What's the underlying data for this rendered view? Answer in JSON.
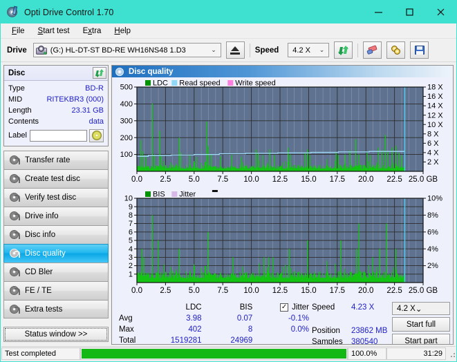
{
  "window": {
    "title": "Opti Drive Control 1.70",
    "app_icon": "disc-pen-icon",
    "minimize": "–",
    "maximize": "□",
    "close": "✕",
    "titlebar_color": "#3ee0cf"
  },
  "menubar": {
    "items": [
      {
        "label": "File",
        "accel": "F"
      },
      {
        "label": "Start test",
        "accel": "S"
      },
      {
        "label": "Extra",
        "accel": "x"
      },
      {
        "label": "Help",
        "accel": "H"
      }
    ]
  },
  "toolbar": {
    "drive_label": "Drive",
    "drive_value": "(G:)  HL-DT-ST BD-RE  WH16NS48 1.D3",
    "drive_icon": "drive-icon",
    "eject_icon": "eject-icon",
    "speed_label": "Speed",
    "speed_value": "4.2 X",
    "refresh_icon": "refresh-icon",
    "erase_icon": "eraser-icon",
    "settings_icon": "gold-discs-icon",
    "save_icon": "save-icon",
    "chevron": "⌄"
  },
  "disc_panel": {
    "title": "Disc",
    "refresh_icon": "refresh-icon",
    "rows": [
      {
        "key": "Type",
        "value": "BD-R"
      },
      {
        "key": "MID",
        "value": "RITEKBR3 (000)"
      },
      {
        "key": "Length",
        "value": "23.31 GB"
      },
      {
        "key": "Contents",
        "value": "data"
      }
    ],
    "label_key": "Label",
    "label_value": "",
    "label_placeholder": "",
    "label_button_icon": "cd-icon"
  },
  "nav": {
    "items": [
      {
        "label": "Transfer rate",
        "icon": "disc-icon",
        "active": false
      },
      {
        "label": "Create test disc",
        "icon": "disc-icon",
        "active": false
      },
      {
        "label": "Verify test disc",
        "icon": "disc-icon",
        "active": false
      },
      {
        "label": "Drive info",
        "icon": "disc-icon",
        "active": false
      },
      {
        "label": "Disc info",
        "icon": "disc-icon",
        "active": false
      },
      {
        "label": "Disc quality",
        "icon": "disc-icon",
        "active": true
      },
      {
        "label": "CD Bler",
        "icon": "disc-icon",
        "active": false
      },
      {
        "label": "FE / TE",
        "icon": "disc-icon",
        "active": false
      },
      {
        "label": "Extra tests",
        "icon": "disc-icon",
        "active": false
      }
    ],
    "status_window_button": "Status window >>"
  },
  "main": {
    "header_title": "Disc quality",
    "header_icon": "disc-icon"
  },
  "stats": {
    "col_headers": [
      "LDC",
      "BIS"
    ],
    "jitter_label": "Jitter",
    "jitter_checked": true,
    "rows": [
      {
        "key": "Avg",
        "ldc": "3.98",
        "bis": "0.07",
        "jitter": "-0.1%"
      },
      {
        "key": "Max",
        "ldc": "402",
        "bis": "8",
        "jitter": "0.0%"
      },
      {
        "key": "Total",
        "ldc": "1519281",
        "bis": "24969",
        "jitter": ""
      }
    ],
    "right": [
      {
        "key": "Speed",
        "value": "4.23 X"
      },
      {
        "key": "Position",
        "value": "23862 MB"
      },
      {
        "key": "Samples",
        "value": "380540"
      }
    ],
    "speed_select": "4.2 X",
    "start_full_button": "Start full",
    "start_part_button": "Start part"
  },
  "statusbar": {
    "message": "Test completed",
    "progress_percent": 100.0,
    "progress_text": "100.0%",
    "elapsed": "31:29"
  },
  "chart_data": [
    {
      "type": "line",
      "id": "ldc-chart",
      "title": "",
      "xlabel": "GB",
      "ylabel": "",
      "xlim": [
        0,
        25.0
      ],
      "xticks": [
        "0.0",
        "2.5",
        "5.0",
        "7.5",
        "10.0",
        "12.5",
        "15.0",
        "17.5",
        "20.0",
        "22.5",
        "25.0 GB"
      ],
      "ylim": [
        0,
        500
      ],
      "yticks": [
        "100",
        "200",
        "300",
        "400",
        "500"
      ],
      "y2lim": [
        0,
        18
      ],
      "y2ticks": [
        "2 X",
        "4 X",
        "6 X",
        "8 X",
        "10 X",
        "12 X",
        "14 X",
        "16 X",
        "18 X"
      ],
      "grid": true,
      "plot_bg": "#5f7390",
      "legend": [
        {
          "name": "LDC",
          "color": "#009000"
        },
        {
          "name": "Read speed",
          "color": "#8fd8f7"
        },
        {
          "name": "Write speed",
          "color": "#ff7fe0"
        }
      ],
      "series": [
        {
          "name": "LDC",
          "color": "#14c414",
          "kind": "impulse",
          "x_end": 23.4,
          "baseline": 30,
          "noise_amp": 28,
          "spikes": [
            {
              "x": 0.35,
              "y": 185
            },
            {
              "x": 0.5,
              "y": 120
            },
            {
              "x": 0.8,
              "y": 95
            },
            {
              "x": 1.35,
              "y": 402
            },
            {
              "x": 1.55,
              "y": 100
            },
            {
              "x": 2.0,
              "y": 240
            },
            {
              "x": 2.15,
              "y": 90
            },
            {
              "x": 3.7,
              "y": 200
            },
            {
              "x": 3.85,
              "y": 110
            },
            {
              "x": 4.6,
              "y": 95
            },
            {
              "x": 5.2,
              "y": 85
            },
            {
              "x": 6.1,
              "y": 295
            },
            {
              "x": 6.25,
              "y": 150
            },
            {
              "x": 6.5,
              "y": 100
            },
            {
              "x": 7.3,
              "y": 90
            },
            {
              "x": 8.3,
              "y": 95
            },
            {
              "x": 9.1,
              "y": 85
            },
            {
              "x": 10.4,
              "y": 130
            },
            {
              "x": 10.6,
              "y": 110
            },
            {
              "x": 11.0,
              "y": 95
            },
            {
              "x": 11.6,
              "y": 130
            },
            {
              "x": 12.0,
              "y": 95
            },
            {
              "x": 13.2,
              "y": 140
            },
            {
              "x": 13.4,
              "y": 100
            },
            {
              "x": 14.7,
              "y": 110
            },
            {
              "x": 14.9,
              "y": 130
            },
            {
              "x": 15.1,
              "y": 95
            },
            {
              "x": 17.4,
              "y": 115
            },
            {
              "x": 17.6,
              "y": 95
            },
            {
              "x": 18.2,
              "y": 100
            },
            {
              "x": 18.6,
              "y": 125
            },
            {
              "x": 19.1,
              "y": 190
            },
            {
              "x": 19.4,
              "y": 100
            },
            {
              "x": 20.1,
              "y": 110
            },
            {
              "x": 20.4,
              "y": 95
            },
            {
              "x": 21.1,
              "y": 140
            },
            {
              "x": 21.4,
              "y": 125
            },
            {
              "x": 21.7,
              "y": 215
            },
            {
              "x": 21.9,
              "y": 120
            },
            {
              "x": 22.3,
              "y": 140
            },
            {
              "x": 22.6,
              "y": 150
            },
            {
              "x": 22.9,
              "y": 110
            },
            {
              "x": 23.1,
              "y": 95
            }
          ]
        },
        {
          "name": "Read speed",
          "color": "#9fdcf8",
          "kind": "step",
          "points": [
            {
              "x": 0.0,
              "y": 3.2
            },
            {
              "x": 1.0,
              "y": 3.2
            },
            {
              "x": 1.0,
              "y": 3.4
            },
            {
              "x": 3.0,
              "y": 3.4
            },
            {
              "x": 3.0,
              "y": 3.5
            },
            {
              "x": 5.0,
              "y": 3.5
            },
            {
              "x": 5.0,
              "y": 3.6
            },
            {
              "x": 7.2,
              "y": 3.6
            },
            {
              "x": 7.2,
              "y": 3.75
            },
            {
              "x": 9.5,
              "y": 3.75
            },
            {
              "x": 9.5,
              "y": 3.85
            },
            {
              "x": 12.3,
              "y": 3.85
            },
            {
              "x": 12.3,
              "y": 3.95
            },
            {
              "x": 15.2,
              "y": 3.95
            },
            {
              "x": 15.2,
              "y": 4.05
            },
            {
              "x": 17.6,
              "y": 4.05
            },
            {
              "x": 17.6,
              "y": 4.15
            },
            {
              "x": 20.3,
              "y": 4.15
            },
            {
              "x": 20.3,
              "y": 4.25
            },
            {
              "x": 23.4,
              "y": 4.25
            }
          ]
        },
        {
          "name": "position-marker",
          "color": "#4fd2f5",
          "kind": "vline",
          "x": 23.4
        }
      ]
    },
    {
      "type": "line",
      "id": "bis-chart",
      "title": "",
      "xlabel": "GB",
      "ylabel": "",
      "xlim": [
        0,
        25.0
      ],
      "xticks": [
        "0.0",
        "2.5",
        "5.0",
        "7.5",
        "10.0",
        "12.5",
        "15.0",
        "17.5",
        "20.0",
        "22.5",
        "25.0 GB"
      ],
      "ylim": [
        0,
        10
      ],
      "yticks": [
        "1",
        "2",
        "3",
        "4",
        "5",
        "6",
        "7",
        "8",
        "9",
        "10"
      ],
      "y2lim": [
        0,
        10
      ],
      "y2ticks": [
        "2%",
        "4%",
        "6%",
        "8%",
        "10%"
      ],
      "grid": true,
      "plot_bg": "#5f7390",
      "legend": [
        {
          "name": "BIS",
          "color": "#009000"
        },
        {
          "name": "Jitter",
          "color": "#d9b8e8"
        }
      ],
      "series": [
        {
          "name": "BIS",
          "color": "#14c414",
          "kind": "impulse",
          "x_end": 23.4,
          "baseline": 1.0,
          "noise_amp": 1.0,
          "spikes": [
            {
              "x": 0.45,
              "y": 4
            },
            {
              "x": 0.6,
              "y": 3
            },
            {
              "x": 1.35,
              "y": 8
            },
            {
              "x": 1.85,
              "y": 5
            },
            {
              "x": 3.7,
              "y": 4
            },
            {
              "x": 6.2,
              "y": 6
            },
            {
              "x": 8.4,
              "y": 3
            },
            {
              "x": 11.1,
              "y": 3
            },
            {
              "x": 11.5,
              "y": 3
            },
            {
              "x": 11.9,
              "y": 3
            },
            {
              "x": 13.3,
              "y": 4
            },
            {
              "x": 14.9,
              "y": 5
            },
            {
              "x": 17.8,
              "y": 5
            },
            {
              "x": 19.4,
              "y": 7
            },
            {
              "x": 19.2,
              "y": 4
            },
            {
              "x": 20.6,
              "y": 3
            },
            {
              "x": 21.2,
              "y": 4
            },
            {
              "x": 21.8,
              "y": 7
            },
            {
              "x": 22.6,
              "y": 4
            }
          ]
        },
        {
          "name": "position-marker",
          "color": "#4fd2f5",
          "kind": "vline",
          "x": 23.4
        }
      ]
    }
  ]
}
